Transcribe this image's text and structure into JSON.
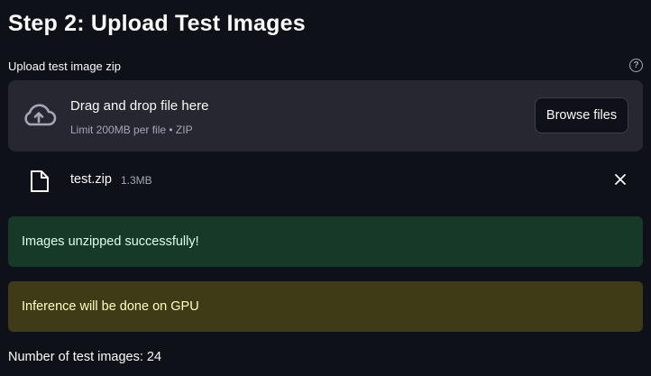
{
  "page": {
    "title": "Step 2: Upload Test Images"
  },
  "uploader": {
    "label": "Upload test image zip",
    "help_icon": "question-circle-icon",
    "drop_title": "Drag and drop file here",
    "drop_subtitle": "Limit 200MB per file • ZIP",
    "browse_label": "Browse files",
    "cloud_icon": "cloud-upload-icon"
  },
  "file": {
    "name": "test.zip",
    "size": "1.3MB",
    "file_icon": "file-icon",
    "remove_icon": "close-icon"
  },
  "alerts": {
    "success": "Images unzipped successfully!",
    "info": "Inference will be done on GPU"
  },
  "summary": {
    "count_text": "Number of test images: 24"
  },
  "colors": {
    "background": "#0e1117",
    "panel": "#262730",
    "success_bg": "#173928",
    "warning_bg": "#3e3b16"
  }
}
